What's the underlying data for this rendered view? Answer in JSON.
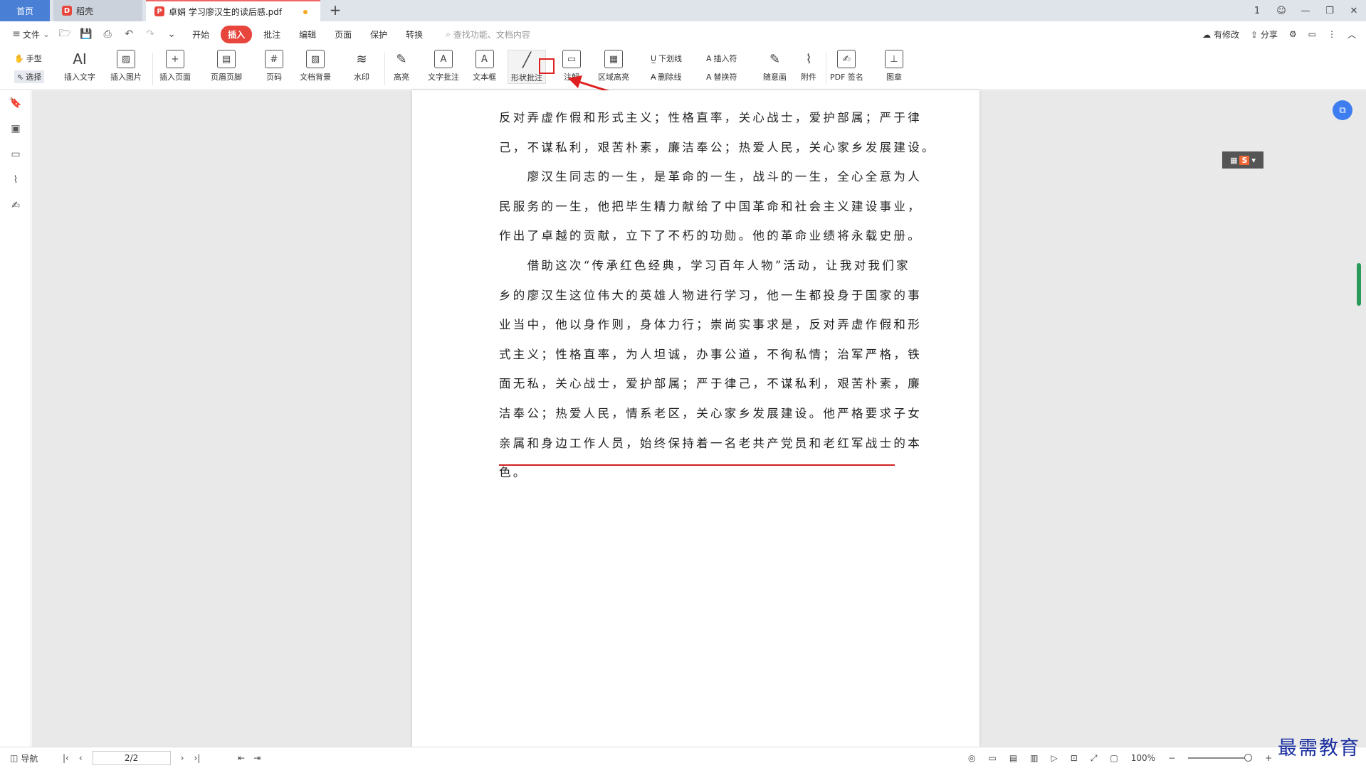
{
  "tabs": {
    "home": "首页",
    "daoke": "稻壳",
    "doc": "卓娟 学习廖汉生的读后感.pdf",
    "add": "+"
  },
  "window_controls": [
    "1",
    "—",
    "❐",
    "✕"
  ],
  "menu": {
    "file": "文件",
    "tabs": [
      "开始",
      "插入",
      "批注",
      "编辑",
      "页面",
      "保护",
      "转换"
    ],
    "active_tab": "插入",
    "search_placeholder": "查找功能、文档内容",
    "right": [
      "有修改",
      "分享"
    ]
  },
  "ribbon": {
    "hand": "手型",
    "select": "选择",
    "insert_text": "插入文字",
    "insert_image": "插入图片",
    "insert_page": "插入页面",
    "header_footer": "页眉页脚",
    "page_number": "页码",
    "doc_background": "文档背景",
    "watermark": "水印",
    "highlight": "高亮",
    "text_annotation": "文字批注",
    "text_box": "文本框",
    "shape_annotation": "形状批注",
    "note": "注解",
    "area_highlight": "区域高亮",
    "underline": "下划线",
    "strikethrough": "删除线",
    "insert_mark": "插入符",
    "replace_mark": "替换符",
    "freehand": "随意画",
    "attachment": "附件",
    "pdf_sign": "PDF 签名",
    "stamp": "图章"
  },
  "document": {
    "lines": [
      "反对弄虚作假和形式主义；性格直率，关心战士，爱护部属；严于律",
      "己，不谋私利，艰苦朴素，廉洁奉公；热爱人民，关心家乡发展建设。",
      "　　廖汉生同志的一生，是革命的一生，战斗的一生，全心全意为人",
      "民服务的一生，他把毕生精力献给了中国革命和社会主义建设事业，",
      "作出了卓越的贡献，立下了不朽的功勋。他的革命业绩将永载史册。",
      "　　借助这次“传承红色经典，学习百年人物”活动，让我对我们家",
      "乡的廖汉生这位伟大的英雄人物进行学习，他一生都投身于国家的事",
      "业当中，他以身作则，身体力行；崇尚实事求是，反对弄虚作假和形",
      "式主义；性格直率，为人坦诚，办事公道，不徇私情；治军严格，铁",
      "面无私，关心战士，爱护部属；严于律己，不谋私利，艰苦朴素，廉",
      "洁奉公；热爱人民，情系老区，关心家乡发展建设。他严格要求子女",
      "亲属和身边工作人员，始终保持着一名老共产党员和老红军战士的本",
      "色。"
    ]
  },
  "status": {
    "nav": "导航",
    "page": "2/2",
    "zoom": "100%"
  },
  "watermark_text": "最需教育",
  "colors": {
    "accent": "#e8453c",
    "home_tab": "#4a7fd6",
    "annotation_red": "#d02020"
  }
}
